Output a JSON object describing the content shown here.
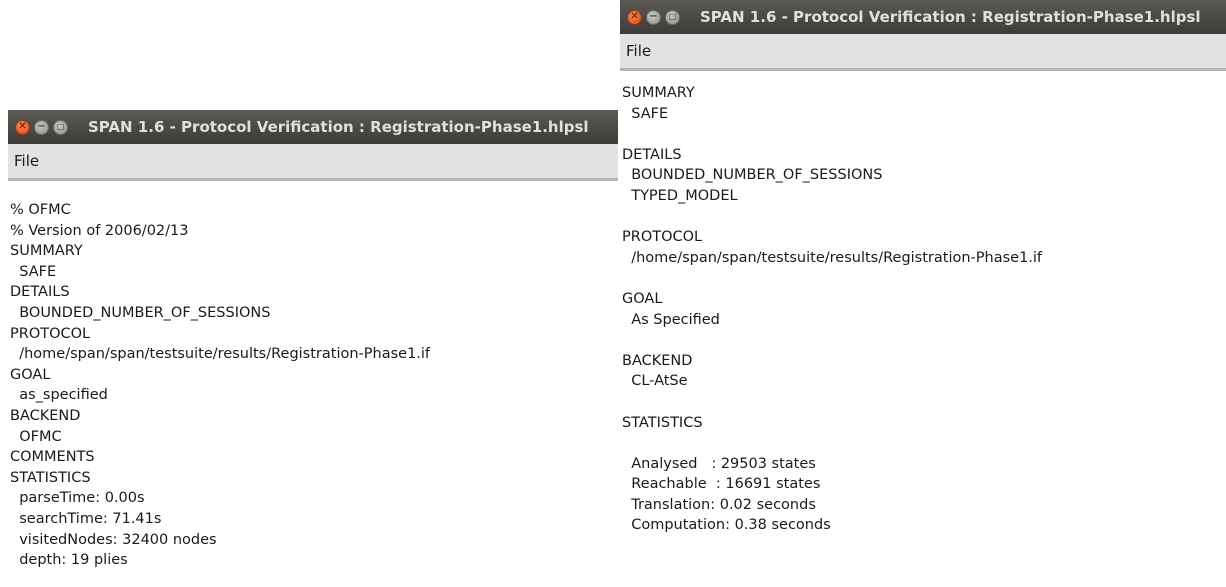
{
  "left_window": {
    "title": "SPAN 1.6 - Protocol Verification : Registration-Phase1.hlpsl",
    "menu": {
      "file": "File"
    },
    "lines": [
      "% OFMC",
      "% Version of 2006/02/13",
      "SUMMARY",
      "  SAFE",
      "DETAILS",
      "  BOUNDED_NUMBER_OF_SESSIONS",
      "PROTOCOL",
      "  /home/span/span/testsuite/results/Registration-Phase1.if",
      "GOAL",
      "  as_specified",
      "BACKEND",
      "  OFMC",
      "COMMENTS",
      "STATISTICS",
      "  parseTime: 0.00s",
      "  searchTime: 71.41s",
      "  visitedNodes: 32400 nodes",
      "  depth: 19 plies"
    ]
  },
  "right_window": {
    "title": "SPAN 1.6 - Protocol Verification : Registration-Phase1.hlpsl",
    "menu": {
      "file": "File"
    },
    "lines": [
      "SUMMARY",
      "  SAFE",
      "",
      "DETAILS",
      "  BOUNDED_NUMBER_OF_SESSIONS",
      "  TYPED_MODEL",
      "",
      "PROTOCOL",
      "  /home/span/span/testsuite/results/Registration-Phase1.if",
      "",
      "GOAL",
      "  As Specified",
      "",
      "BACKEND",
      "  CL-AtSe",
      "",
      "STATISTICS",
      "",
      "  Analysed   : 29503 states",
      "  Reachable  : 16691 states",
      "  Translation: 0.02 seconds",
      "  Computation: 0.38 seconds"
    ]
  },
  "icons": {
    "close": "close-icon",
    "minimize": "minimize-icon",
    "maximize": "maximize-icon"
  },
  "colors": {
    "titlebar": "#3c3b37",
    "close_button": "#df4a16",
    "menubar": "#e3e2e0"
  }
}
